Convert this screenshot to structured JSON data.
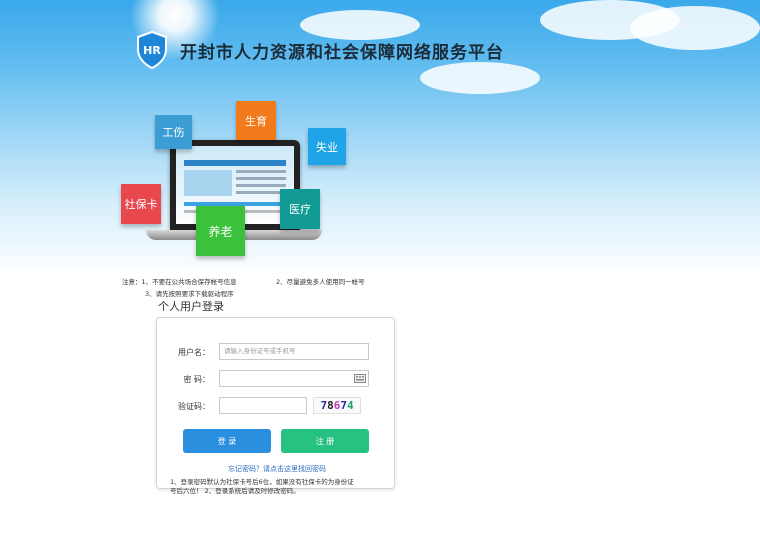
{
  "header": {
    "logo_text": "HR",
    "title": "开封市人力资源和社会保障网络服务平台"
  },
  "tiles": {
    "injury": "工伤",
    "birth": "生育",
    "unemployment": "失业",
    "card": "社保卡",
    "medical": "医疗",
    "pension": "养老"
  },
  "notice": {
    "line1": "注意：1、不要在公共场合保存帐号信息",
    "line2": "2、尽量避免多人使用同一帐号",
    "line3": "3、请先按照要求下载驱动程序"
  },
  "login": {
    "title": "个人用户登录",
    "username_label": "用户名：",
    "username_placeholder": "请输入身份证号或手机号",
    "password_label": "密  码：",
    "captcha_label": "验证码：",
    "captcha_chars": [
      "7",
      "8",
      "6",
      "7",
      "4"
    ],
    "login_button": "登 录",
    "register_button": "注 册",
    "forgot_link": "忘记密码？请点击这里找回密码",
    "tip_line1": "1、登录密码默认为社保卡号后6位，如果没有社保卡的为身份证",
    "tip_line2": "号后六位！ 2、登录系统后请及时修改密码。"
  },
  "colors": {
    "tile_injury": "#3b9dd3",
    "tile_birth": "#f07a1c",
    "tile_unemployment": "#1fa4e8",
    "tile_card": "#e8484d",
    "tile_medical": "#129a94",
    "tile_pension": "#3cc13c",
    "login_button": "#2b8fdf",
    "register_button": "#27c182",
    "link": "#2a6ebd"
  }
}
